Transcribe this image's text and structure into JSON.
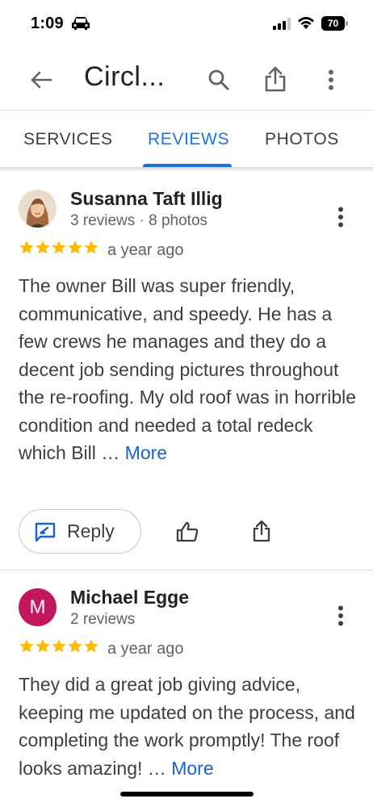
{
  "status_bar": {
    "time": "1:09",
    "battery": "70"
  },
  "app_bar": {
    "title": "Circl..."
  },
  "tabs": [
    {
      "label": "SERVICES",
      "selected": false
    },
    {
      "label": "REVIEWS",
      "selected": true
    },
    {
      "label": "PHOTOS",
      "selected": false
    }
  ],
  "colors": {
    "accent": "#1a73e8",
    "star": "#fbbc04",
    "link": "#1a62c9",
    "avatar_michael": "#c2185b"
  },
  "reviews": [
    {
      "name": "Susanna Taft Illig",
      "meta": "3 reviews · 8 photos",
      "rating": 5,
      "date": "a year ago",
      "text": "The owner Bill was super friendly, communicative, and speedy. He has a few crews he manages and they do a decent job sending pictures throughout the re-roofing. My old roof was in horrible condition and needed a total redeck which Bill … ",
      "more": "More",
      "reply_label": "Reply",
      "avatar": "photo-avatar"
    },
    {
      "name": "Michael Egge",
      "meta": "2 reviews",
      "rating": 5,
      "date": "a year ago",
      "text": "They did a great job giving advice, keeping me updated on the process, and completing the work promptly! The roof looks amazing! … ",
      "more": "More",
      "avatar_letter": "M"
    }
  ]
}
